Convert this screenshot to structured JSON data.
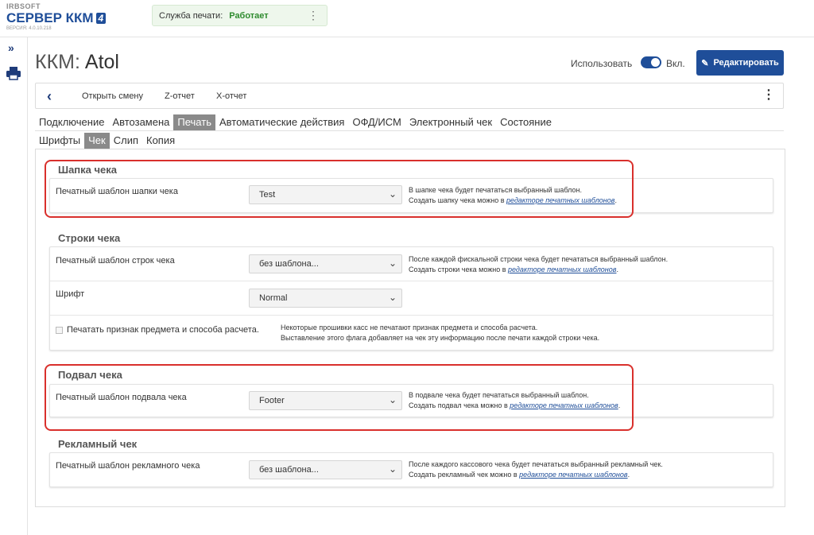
{
  "brand": {
    "small": "IRBSOFT",
    "main": "СЕРВЕР ККМ",
    "badge": "4",
    "version": "ВЕРСИЯ: 4.0.10.218"
  },
  "service": {
    "label": "Служба печати:",
    "status": "Работает",
    "menu": "⋮"
  },
  "sidebar": {
    "expand": "»"
  },
  "page": {
    "prefix": "ККМ:",
    "name": "Atol"
  },
  "header": {
    "use_label": "Использовать",
    "on_label": "Вкл.",
    "edit_label": "Редактировать",
    "edit_icon": "✎"
  },
  "actions": {
    "back": "‹",
    "open_shift": "Открыть смену",
    "z_report": "Z-отчет",
    "x_report": "X-отчет",
    "menu": "⋮"
  },
  "tabs": [
    "Подключение",
    "Автозамена",
    "Печать",
    "Автоматические действия",
    "ОФД/ИСМ",
    "Электронный чек",
    "Состояние"
  ],
  "subtabs": [
    "Шрифты",
    "Чек",
    "Слип",
    "Копия"
  ],
  "sections": {
    "header": {
      "title": "Шапка чека",
      "label": "Печатный шаблон шапки чека",
      "value": "Test",
      "hint1": "В шапке чека будет печататься выбранный шаблон.",
      "hint2": "Создать шапку чека можно в ",
      "link": "редакторе печатных шаблонов",
      "dot": "."
    },
    "rows": {
      "title": "Строки чека",
      "label": "Печатный шаблон строк чека",
      "value": "без шаблона...",
      "hint1": "После каждой фискальной строки чека будет печататься выбранный шаблон.",
      "hint2": "Создать строки чека можно в ",
      "link": "редакторе печатных шаблонов",
      "dot": ".",
      "font_label": "Шрифт",
      "font_value": "Normal",
      "check_label": "Печатать признак предмета и способа расчета.",
      "check_hint1": "Некоторые прошивки касс не печатают признак предмета и способа расчета.",
      "check_hint2": "Выставление этого флага добавляет на чек эту информацию после печати каждой строки чека."
    },
    "footer": {
      "title": "Подвал чека",
      "label": "Печатный шаблон подвала чека",
      "value": "Footer",
      "hint1": "В подвале чека будет печататься выбранный шаблон.",
      "hint2": "Создать подвал чека можно в ",
      "link": "редакторе печатных шаблонов",
      "dot": "."
    },
    "ad": {
      "title": "Рекламный чек",
      "label": "Печатный шаблон рекламного чека",
      "value": "без шаблона...",
      "hint1": "После каждого кассового чека будет печататься выбранный рекламный чек.",
      "hint2": "Создать рекламный чек можно в ",
      "link": "редакторе печатных шаблонов",
      "dot": "."
    }
  },
  "colors": {
    "accent": "#1f4e99",
    "highlight": "#d9302c",
    "status_ok": "#2e8b2e"
  }
}
